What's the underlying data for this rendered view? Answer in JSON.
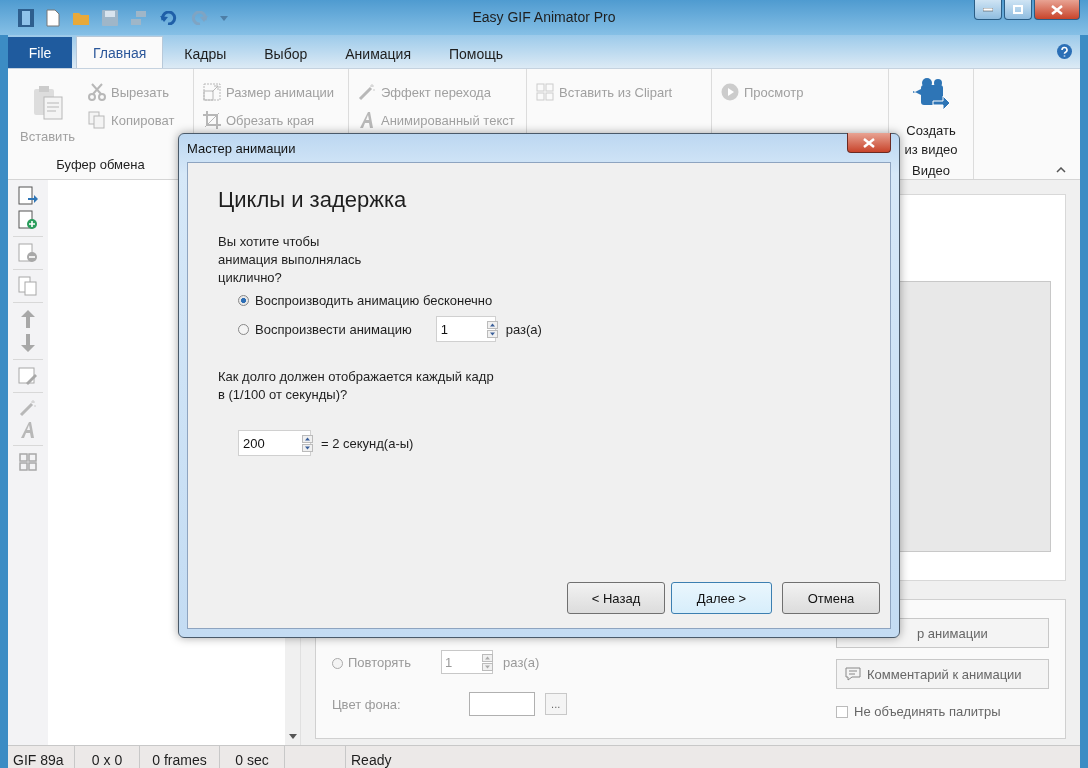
{
  "window": {
    "title": "Easy GIF Animator Pro"
  },
  "menu_tabs": [
    {
      "label": "File",
      "kind": "file",
      "selected": false
    },
    {
      "label": "Главная",
      "kind": "tab",
      "selected": true
    },
    {
      "label": "Кадры",
      "kind": "tab",
      "selected": false
    },
    {
      "label": "Выбор",
      "kind": "tab",
      "selected": false
    },
    {
      "label": "Анимация",
      "kind": "tab",
      "selected": false
    },
    {
      "label": "Помощь",
      "kind": "tab",
      "selected": false
    }
  ],
  "ribbon": {
    "groups": [
      {
        "label": "Буфер обмена",
        "items": [
          {
            "label": "Вставить",
            "kind": "large",
            "disabled": true
          },
          {
            "label": "Вырезать",
            "kind": "small",
            "disabled": true
          },
          {
            "label": "Копироват",
            "kind": "small",
            "disabled": true
          }
        ]
      },
      {
        "items": [
          {
            "label": "Размер анимации",
            "kind": "small",
            "disabled": true
          },
          {
            "label": "Обрезать края",
            "kind": "small",
            "disabled": true
          }
        ]
      },
      {
        "items": [
          {
            "label": "Эффект перехода",
            "kind": "small",
            "disabled": true
          },
          {
            "label": "Анимированный текст",
            "kind": "small",
            "disabled": true
          }
        ]
      },
      {
        "items": [
          {
            "label": "Вставить из Clipart",
            "kind": "small",
            "disabled": true
          }
        ]
      },
      {
        "items": [
          {
            "label": "Просмотр",
            "kind": "small",
            "disabled": true
          }
        ]
      },
      {
        "label": "Видео",
        "items": [
          {
            "label": "Создать из видео",
            "kind": "large",
            "disabled": false
          }
        ]
      }
    ]
  },
  "properties": {
    "repeat": {
      "label": "Повторять",
      "selected": false,
      "count": "1",
      "unit": "раз(а)"
    },
    "background_color_label": "Цвет фона:",
    "browse_button": "...",
    "buttons": [
      "р анимации",
      "Комментарий к анимации"
    ],
    "no_merge_palettes": {
      "label": "Не объединять палитры",
      "checked": false
    }
  },
  "status_bar": [
    "GIF 89a",
    "0 x 0",
    "0 frames",
    "0 sec",
    "Ready"
  ],
  "dialog": {
    "title": "Мастер анимации",
    "heading": "Циклы и задержка",
    "question": "Вы хотите чтобы\nанимация выполнялась\nциклично?",
    "loop_options": [
      {
        "label": "Воспроизводить анимацию бесконечно",
        "selected": true
      },
      {
        "label": "Воспроизвести анимацию",
        "selected": false,
        "count": "1",
        "unit": "раз(а)"
      }
    ],
    "delay_question": "Как долго должен отображается каждый кадр\nв (1/100 от секунды)?",
    "delay": {
      "value": "200",
      "result": "= 2 секунд(а-ы)"
    },
    "buttons": [
      {
        "label": "< Назад",
        "default": false
      },
      {
        "label": "Далее >",
        "default": true
      },
      {
        "label": "Отмена",
        "default": false
      }
    ]
  }
}
